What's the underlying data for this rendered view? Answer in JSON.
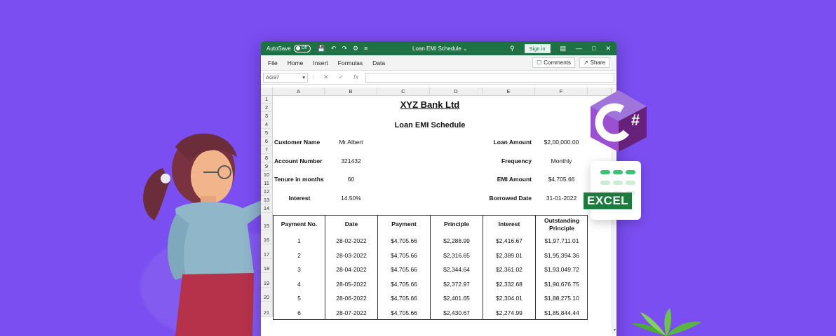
{
  "window": {
    "autosave_label": "AutoSave",
    "autosave_state": "Off",
    "title": "Loan EMI Schedule",
    "signin_label": "Sign in"
  },
  "menu": {
    "items": [
      "File",
      "Home",
      "Insert",
      "Formulas",
      "Data"
    ],
    "comments_label": "Comments",
    "share_label": "Share"
  },
  "formula_bar": {
    "name_box": "AG97",
    "fx_label": "fx",
    "value": ""
  },
  "columns": [
    "A",
    "B",
    "C",
    "D",
    "E",
    "F"
  ],
  "rows": [
    "1",
    "2",
    "3",
    "4",
    "5",
    "6",
    "7",
    "8",
    "9",
    "10",
    "11",
    "12",
    "13",
    "14",
    "15",
    "16",
    "17",
    "18",
    "19",
    "20",
    "21"
  ],
  "sheet": {
    "bank_name": "XYZ Bank Ltd",
    "schedule_title": "Loan EMI Schedule",
    "details_left": [
      {
        "label": "Customer Name",
        "value": "Mr.Albert"
      },
      {
        "label": "Account Number",
        "value": "321432"
      },
      {
        "label": "Tenure in months",
        "value": "60"
      },
      {
        "label": "Interest",
        "value": "14.50%"
      }
    ],
    "details_right": [
      {
        "label": "Loan Amount",
        "value": "$2,00,000.00"
      },
      {
        "label": "Frequency",
        "value": "Monthly"
      },
      {
        "label": "EMI Amount",
        "value": "$4,705.66"
      },
      {
        "label": "Borrowed Date",
        "value": "31-01-2022"
      }
    ],
    "table_headers": [
      "Payment No.",
      "Date",
      "Payment",
      "Principle",
      "Interest",
      "Outstanding Principle"
    ],
    "table_rows": [
      [
        "1",
        "28-02-2022",
        "$4,705.66",
        "$2,288.99",
        "$2,416.67",
        "$1,97,711.01"
      ],
      [
        "2",
        "28-03-2022",
        "$4,705.66",
        "$2,316.65",
        "$2,389.01",
        "$1,95,394.36"
      ],
      [
        "3",
        "28-04-2022",
        "$4,705.66",
        "$2,344.64",
        "$2,361.02",
        "$1,93,049.72"
      ],
      [
        "4",
        "28-05-2022",
        "$4,705.66",
        "$2,372.97",
        "$2,332.68",
        "$1,90,676.75"
      ],
      [
        "5",
        "28-06-2022",
        "$4,705.66",
        "$2,401.65",
        "$2,304.01",
        "$1,88,275.10"
      ],
      [
        "6",
        "28-07-2022",
        "$4,705.66",
        "$2,430.67",
        "$2,274.99",
        "$1,85,844.44"
      ]
    ]
  },
  "badges": {
    "csharp_symbol": "#",
    "excel_label": "EXCEL"
  },
  "colors": {
    "background": "#7a4ef0",
    "excel_green": "#1e7145",
    "csharp_purple": "#68217a"
  }
}
